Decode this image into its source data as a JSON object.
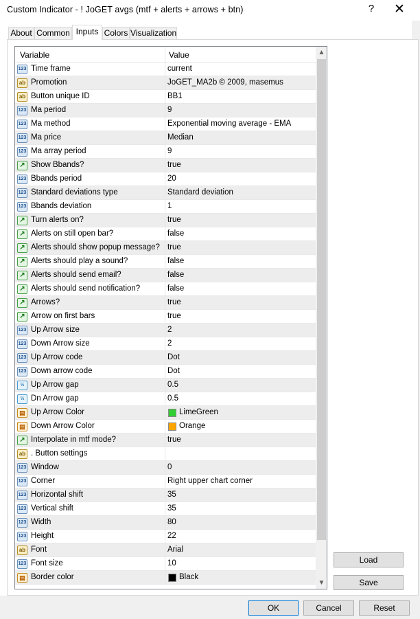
{
  "window": {
    "title": "Custom Indicator - ! JoGET avgs (mtf + alerts + arrows + btn)",
    "help_glyph": "?",
    "close_glyph": "✕"
  },
  "tabs": [
    {
      "label": "About"
    },
    {
      "label": "Common"
    },
    {
      "label": "Inputs",
      "active": true
    },
    {
      "label": "Colors"
    },
    {
      "label": "Visualization"
    }
  ],
  "grid": {
    "col_variable": "Variable",
    "col_value": "Value",
    "rows": [
      {
        "type": "int",
        "icon": "123",
        "name": "Time frame",
        "value": "current"
      },
      {
        "type": "string",
        "icon": "ab",
        "name": "Promotion",
        "value": "JoGET_MA2b © 2009, masemus"
      },
      {
        "type": "string",
        "icon": "ab",
        "name": "Button unique ID",
        "value": "BB1"
      },
      {
        "type": "int",
        "icon": "123",
        "name": "Ma period",
        "value": "9"
      },
      {
        "type": "int",
        "icon": "123",
        "name": "Ma method",
        "value": "Exponential moving average - EMA"
      },
      {
        "type": "int",
        "icon": "123",
        "name": "Ma price",
        "value": "Median"
      },
      {
        "type": "int",
        "icon": "123",
        "name": "Ma array period",
        "value": "9"
      },
      {
        "type": "bool",
        "icon": "↗",
        "name": "Show Bbands?",
        "value": "true"
      },
      {
        "type": "int",
        "icon": "123",
        "name": "Bbands period",
        "value": "20"
      },
      {
        "type": "int",
        "icon": "123",
        "name": "Standard deviations type",
        "value": "Standard deviation"
      },
      {
        "type": "int",
        "icon": "123",
        "name": "Bbands deviation",
        "value": "1"
      },
      {
        "type": "bool",
        "icon": "↗",
        "name": "Turn alerts on?",
        "value": "true"
      },
      {
        "type": "bool",
        "icon": "↗",
        "name": "Alerts on still open bar?",
        "value": "false"
      },
      {
        "type": "bool",
        "icon": "↗",
        "name": "Alerts should show popup message?",
        "value": "true"
      },
      {
        "type": "bool",
        "icon": "↗",
        "name": "Alerts should play a sound?",
        "value": "false"
      },
      {
        "type": "bool",
        "icon": "↗",
        "name": "Alerts should send email?",
        "value": "false"
      },
      {
        "type": "bool",
        "icon": "↗",
        "name": "Alerts should send notification?",
        "value": "false"
      },
      {
        "type": "bool",
        "icon": "↗",
        "name": "Arrows?",
        "value": "true"
      },
      {
        "type": "bool",
        "icon": "↗",
        "name": "Arrow on first bars",
        "value": "true"
      },
      {
        "type": "int",
        "icon": "123",
        "name": "Up Arrow size",
        "value": "2"
      },
      {
        "type": "int",
        "icon": "123",
        "name": "Down Arrow size",
        "value": "2"
      },
      {
        "type": "int",
        "icon": "123",
        "name": "Up Arrow code",
        "value": "Dot"
      },
      {
        "type": "int",
        "icon": "123",
        "name": "Down arrow code",
        "value": "Dot"
      },
      {
        "type": "frac",
        "icon": "½",
        "name": "Up Arrow gap",
        "value": "0.5"
      },
      {
        "type": "frac",
        "icon": "½",
        "name": "Dn Arrow gap",
        "value": "0.5"
      },
      {
        "type": "color",
        "icon": "▤",
        "name": "Up Arrow Color",
        "value": "LimeGreen",
        "swatch": "#32cd32"
      },
      {
        "type": "color",
        "icon": "▤",
        "name": "Down Arrow Color",
        "value": "Orange",
        "swatch": "#ffa500"
      },
      {
        "type": "bool",
        "icon": "↗",
        "name": "Interpolate in mtf mode?",
        "value": "true"
      },
      {
        "type": "string",
        "icon": "ab",
        "name": ".          Button settings",
        "value": ""
      },
      {
        "type": "int",
        "icon": "123",
        "name": "Window",
        "value": "0"
      },
      {
        "type": "int",
        "icon": "123",
        "name": "Corner",
        "value": "Right upper chart corner"
      },
      {
        "type": "int",
        "icon": "123",
        "name": "Horizontal shift",
        "value": "35"
      },
      {
        "type": "int",
        "icon": "123",
        "name": "Vertical shift",
        "value": "35"
      },
      {
        "type": "int",
        "icon": "123",
        "name": "Width",
        "value": "80"
      },
      {
        "type": "int",
        "icon": "123",
        "name": "Height",
        "value": "22"
      },
      {
        "type": "string",
        "icon": "ab",
        "name": "Font",
        "value": "Arial"
      },
      {
        "type": "int",
        "icon": "123",
        "name": "Font size",
        "value": "10"
      },
      {
        "type": "color",
        "icon": "▤",
        "name": "Border color",
        "value": "Black",
        "swatch": "#000000"
      }
    ]
  },
  "side_buttons": {
    "load": "Load",
    "save": "Save"
  },
  "footer_buttons": {
    "ok": "OK",
    "cancel": "Cancel",
    "reset": "Reset"
  },
  "scroll": {
    "up": "▲",
    "down": "▼"
  }
}
